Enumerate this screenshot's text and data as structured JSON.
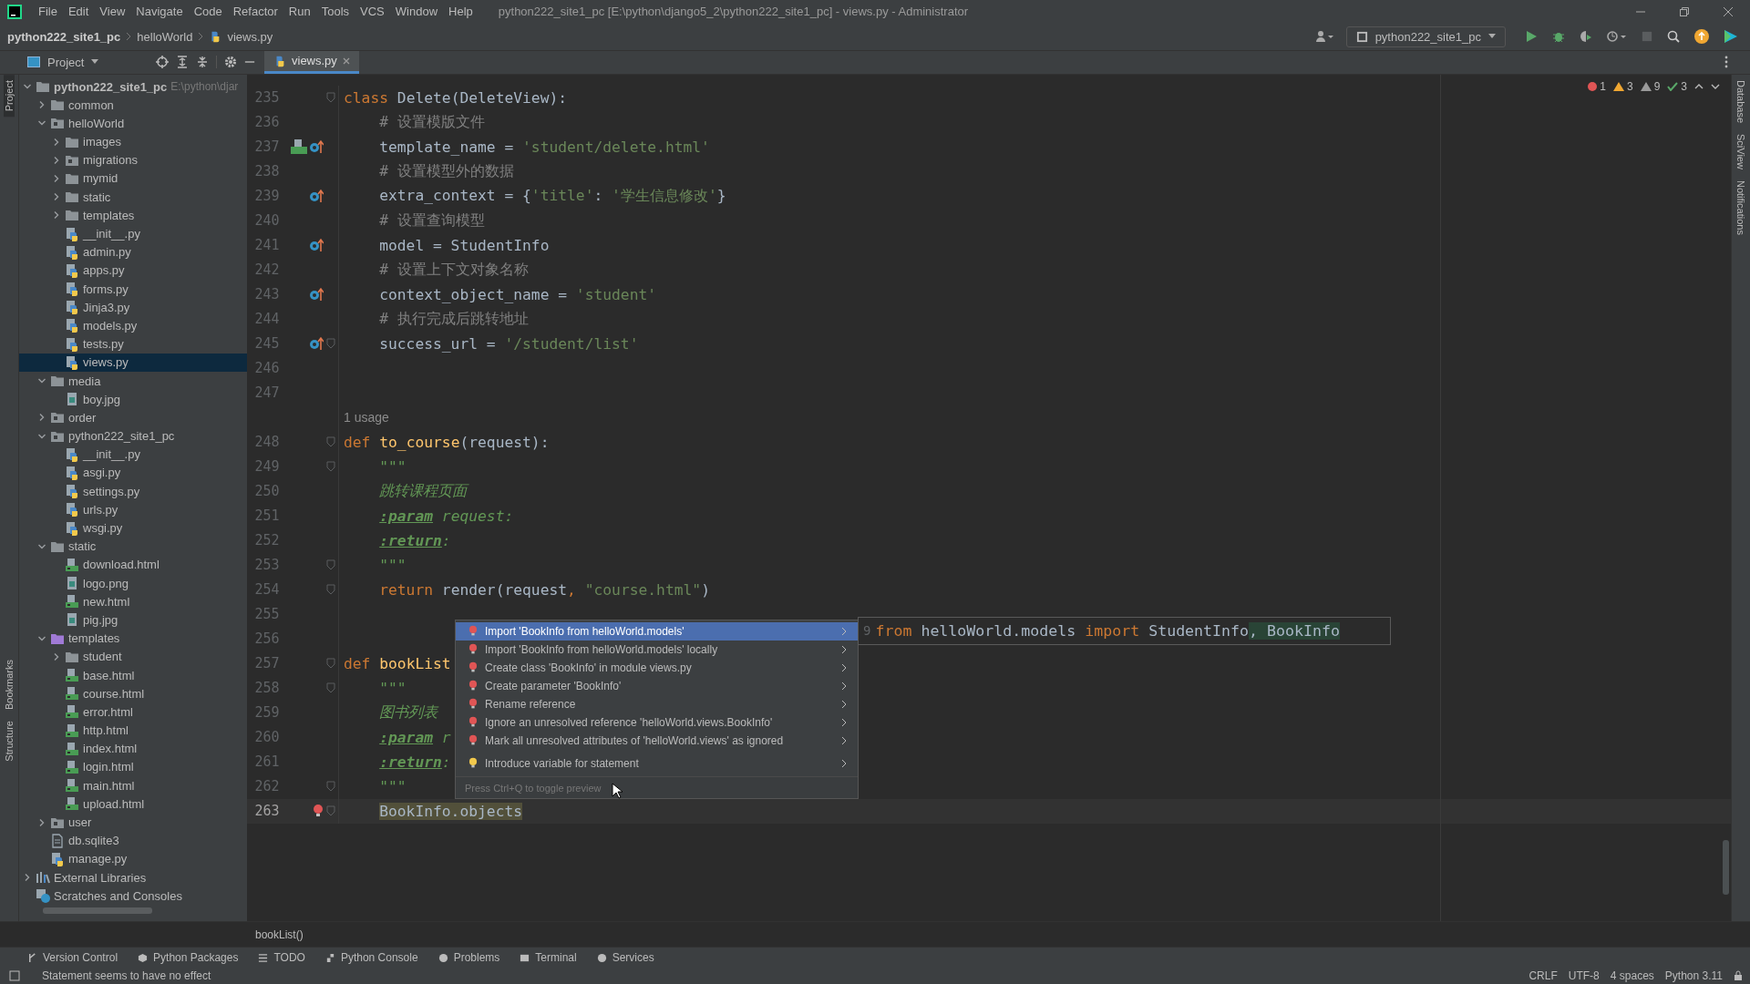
{
  "window": {
    "title": "python222_site1_pc [E:\\python\\django5_2\\python222_site1_pc] - views.py - Administrator"
  },
  "menu": [
    "File",
    "Edit",
    "View",
    "Navigate",
    "Code",
    "Refactor",
    "Run",
    "Tools",
    "VCS",
    "Window",
    "Help"
  ],
  "breadcrumb": [
    "python222_site1_pc",
    "helloWorld",
    "views.py"
  ],
  "run_config": "python222_site1_pc",
  "project_panel": {
    "title": "Project"
  },
  "left_stripe": [
    "Project",
    "Bookmarks",
    "Structure"
  ],
  "right_stripe": [
    "Database",
    "SciView",
    "Notifications"
  ],
  "tabs": [
    {
      "label": "views.py",
      "selected": true
    }
  ],
  "project_tree": [
    {
      "label": "python222_site1_pc",
      "hint": "E:\\python\\djar",
      "kind": "folder",
      "expanded": true,
      "selected": false,
      "children": [
        {
          "label": "common",
          "kind": "folder",
          "expanded": false,
          "selected": false
        },
        {
          "label": "helloWorld",
          "kind": "package",
          "expanded": true,
          "selected": false,
          "children": [
            {
              "label": "images",
              "kind": "folder",
              "expanded": false,
              "selected": false
            },
            {
              "label": "migrations",
              "kind": "package",
              "expanded": false,
              "selected": false
            },
            {
              "label": "mymid",
              "kind": "folder",
              "expanded": false,
              "selected": false
            },
            {
              "label": "static",
              "kind": "folder",
              "expanded": false,
              "selected": false
            },
            {
              "label": "templates",
              "kind": "folder",
              "expanded": false,
              "selected": false
            },
            {
              "label": "__init__.py",
              "kind": "python",
              "selected": false
            },
            {
              "label": "admin.py",
              "kind": "python",
              "selected": false
            },
            {
              "label": "apps.py",
              "kind": "python",
              "selected": false
            },
            {
              "label": "forms.py",
              "kind": "python",
              "selected": false
            },
            {
              "label": "Jinja3.py",
              "kind": "python",
              "selected": false
            },
            {
              "label": "models.py",
              "kind": "python",
              "selected": false
            },
            {
              "label": "tests.py",
              "kind": "python",
              "selected": false
            },
            {
              "label": "views.py",
              "kind": "python",
              "selected": true
            }
          ]
        },
        {
          "label": "media",
          "kind": "folder",
          "expanded": true,
          "selected": false,
          "children": [
            {
              "label": "boy.jpg",
              "kind": "image",
              "selected": false
            }
          ]
        },
        {
          "label": "order",
          "kind": "package",
          "expanded": false,
          "selected": false
        },
        {
          "label": "python222_site1_pc",
          "kind": "package",
          "expanded": true,
          "selected": false,
          "children": [
            {
              "label": "__init__.py",
              "kind": "python",
              "selected": false
            },
            {
              "label": "asgi.py",
              "kind": "python",
              "selected": false
            },
            {
              "label": "settings.py",
              "kind": "python",
              "selected": false
            },
            {
              "label": "urls.py",
              "kind": "python",
              "selected": false
            },
            {
              "label": "wsgi.py",
              "kind": "python",
              "selected": false
            }
          ]
        },
        {
          "label": "static",
          "kind": "folder",
          "expanded": true,
          "selected": false,
          "children": [
            {
              "label": "download.html",
              "kind": "html",
              "selected": false
            },
            {
              "label": "logo.png",
              "kind": "image",
              "selected": false
            },
            {
              "label": "new.html",
              "kind": "html",
              "selected": false
            },
            {
              "label": "pig.jpg",
              "kind": "image",
              "selected": false
            }
          ]
        },
        {
          "label": "templates",
          "kind": "template-folder",
          "expanded": true,
          "selected": false,
          "children": [
            {
              "label": "student",
              "kind": "folder",
              "expanded": false,
              "selected": false
            },
            {
              "label": "base.html",
              "kind": "html",
              "selected": false
            },
            {
              "label": "course.html",
              "kind": "html",
              "selected": false
            },
            {
              "label": "error.html",
              "kind": "html",
              "selected": false
            },
            {
              "label": "http.html",
              "kind": "html",
              "selected": false
            },
            {
              "label": "index.html",
              "kind": "html",
              "selected": false
            },
            {
              "label": "login.html",
              "kind": "html",
              "selected": false
            },
            {
              "label": "main.html",
              "kind": "html",
              "selected": false
            },
            {
              "label": "upload.html",
              "kind": "html",
              "selected": false
            }
          ]
        },
        {
          "label": "user",
          "kind": "package",
          "expanded": false,
          "selected": false
        },
        {
          "label": "db.sqlite3",
          "kind": "database",
          "selected": false
        },
        {
          "label": "manage.py",
          "kind": "python",
          "selected": false
        }
      ]
    },
    {
      "label": "External Libraries",
      "kind": "library",
      "expanded": false,
      "selected": false
    },
    {
      "label": "Scratches and Consoles",
      "kind": "scratch",
      "selected": false
    }
  ],
  "inspections": [
    {
      "kind": "error",
      "count": "1"
    },
    {
      "kind": "warning",
      "count": "3"
    },
    {
      "kind": "weak",
      "count": "9"
    },
    {
      "kind": "typo",
      "count": "3"
    }
  ],
  "code": [
    {
      "kind": "code",
      "number": "235",
      "fold": true,
      "current": false,
      "tokens": [
        {
          "kind": "keyword",
          "text": "class "
        },
        {
          "kind": "plain",
          "text": "Delete(DeleteView):"
        }
      ],
      "children": [
        {
          "kind": "code",
          "number": "236",
          "fold": false,
          "current": false,
          "tokens": [
            {
              "kind": "comment",
              "text": "# 设置模版文件"
            }
          ]
        },
        {
          "kind": "code",
          "number": "237",
          "gutter": {
            "kind": "html-override"
          },
          "fold": false,
          "current": false,
          "tokens": [
            {
              "kind": "plain",
              "text": "template_name = "
            },
            {
              "kind": "string",
              "text": "'student/delete.html'"
            }
          ]
        },
        {
          "kind": "code",
          "number": "238",
          "fold": false,
          "current": false,
          "tokens": [
            {
              "kind": "comment",
              "text": "# 设置模型外的数据"
            }
          ]
        },
        {
          "kind": "code",
          "number": "239",
          "gutter": {
            "kind": "override"
          },
          "fold": false,
          "current": false,
          "tokens": [
            {
              "kind": "plain",
              "text": "extra_context = {"
            },
            {
              "kind": "string",
              "text": "'title'"
            },
            {
              "kind": "plain",
              "text": ": "
            },
            {
              "kind": "string",
              "text": "'学生信息修改'"
            },
            {
              "kind": "plain",
              "text": "}"
            }
          ]
        },
        {
          "kind": "code",
          "number": "240",
          "fold": false,
          "current": false,
          "tokens": [
            {
              "kind": "comment",
              "text": "# 设置查询模型"
            }
          ]
        },
        {
          "kind": "code",
          "number": "241",
          "gutter": {
            "kind": "override"
          },
          "fold": false,
          "current": false,
          "tokens": [
            {
              "kind": "plain",
              "text": "model = StudentInfo"
            }
          ]
        },
        {
          "kind": "code",
          "number": "242",
          "fold": false,
          "current": false,
          "tokens": [
            {
              "kind": "comment",
              "text": "# 设置上下文对象名称"
            }
          ]
        },
        {
          "kind": "code",
          "number": "243",
          "gutter": {
            "kind": "override"
          },
          "fold": false,
          "current": false,
          "tokens": [
            {
              "kind": "plain",
              "text": "context_object_name = "
            },
            {
              "kind": "string",
              "text": "'student'"
            }
          ]
        },
        {
          "kind": "code",
          "number": "244",
          "fold": false,
          "current": false,
          "tokens": [
            {
              "kind": "comment",
              "text": "# 执行完成后跳转地址"
            }
          ]
        },
        {
          "kind": "code",
          "number": "245",
          "gutter": {
            "kind": "override"
          },
          "fold": true,
          "current": false,
          "tokens": [
            {
              "kind": "plain",
              "text": "success_url = "
            },
            {
              "kind": "string",
              "text": "'/student/list'"
            }
          ]
        }
      ]
    },
    {
      "kind": "code",
      "number": "246",
      "fold": false,
      "current": false
    },
    {
      "kind": "code",
      "number": "247",
      "fold": false,
      "current": false
    },
    {
      "kind": "inlay",
      "text": "1 usage"
    },
    {
      "kind": "code",
      "number": "248",
      "fold": true,
      "current": false,
      "tokens": [
        {
          "kind": "keyword",
          "text": "def "
        },
        {
          "kind": "function",
          "text": "to_course"
        },
        {
          "kind": "plain",
          "text": "(request):"
        }
      ],
      "children": [
        {
          "kind": "code",
          "number": "249",
          "fold": true,
          "current": false,
          "tokens": [
            {
              "kind": "docstring",
              "text": "\"\"\""
            }
          ]
        },
        {
          "kind": "code",
          "number": "250",
          "fold": false,
          "current": false,
          "tokens": [
            {
              "kind": "docstring",
              "text": "跳转课程页面"
            }
          ]
        },
        {
          "kind": "code",
          "number": "251",
          "fold": false,
          "current": false,
          "tokens": [
            {
              "kind": "doctag",
              "text": ":param"
            },
            {
              "kind": "docstring",
              "text": " request:"
            }
          ]
        },
        {
          "kind": "code",
          "number": "252",
          "fold": false,
          "current": false,
          "tokens": [
            {
              "kind": "doctag",
              "text": ":return"
            },
            {
              "kind": "docstring",
              "text": ":"
            }
          ]
        },
        {
          "kind": "code",
          "number": "253",
          "fold": true,
          "current": false,
          "tokens": [
            {
              "kind": "docstring",
              "text": "\"\"\""
            }
          ]
        },
        {
          "kind": "code",
          "number": "254",
          "fold": true,
          "current": false,
          "tokens": [
            {
              "kind": "keyword",
              "text": "return"
            },
            {
              "kind": "plain",
              "text": " render(request"
            },
            {
              "kind": "keyword",
              "text": ", "
            },
            {
              "kind": "string",
              "text": "\"course.html\""
            },
            {
              "kind": "plain",
              "text": ")"
            }
          ]
        }
      ]
    },
    {
      "kind": "code",
      "number": "255",
      "fold": false,
      "current": false
    },
    {
      "kind": "code",
      "number": "256",
      "fold": false,
      "current": false
    },
    {
      "kind": "code",
      "number": "257",
      "fold": true,
      "current": false,
      "tokens": [
        {
          "kind": "keyword",
          "text": "def "
        },
        {
          "kind": "function",
          "text": "bookList"
        }
      ],
      "children": [
        {
          "kind": "code",
          "number": "258",
          "fold": true,
          "current": false,
          "tokens": [
            {
              "kind": "docstring",
              "text": "\"\"\""
            }
          ]
        },
        {
          "kind": "code",
          "number": "259",
          "fold": false,
          "current": false,
          "tokens": [
            {
              "kind": "docstring",
              "text": "图书列表"
            }
          ]
        },
        {
          "kind": "code",
          "number": "260",
          "fold": false,
          "current": false,
          "tokens": [
            {
              "kind": "doctag",
              "text": ":param"
            },
            {
              "kind": "docstring",
              "text": " r"
            }
          ]
        },
        {
          "kind": "code",
          "number": "261",
          "fold": false,
          "current": false,
          "tokens": [
            {
              "kind": "doctag",
              "text": ":return"
            },
            {
              "kind": "docstring",
              "text": ":"
            }
          ]
        },
        {
          "kind": "code",
          "number": "262",
          "fold": true,
          "current": false,
          "tokens": [
            {
              "kind": "docstring",
              "text": "\"\"\""
            }
          ]
        },
        {
          "kind": "code",
          "number": "263",
          "gutter": {
            "kind": "error-bulb"
          },
          "fold": true,
          "current": true,
          "tokens": [
            {
              "kind": "unresolved",
              "text": "BookInfo.objects"
            }
          ]
        }
      ]
    }
  ],
  "quick_fix_menu": {
    "items": [
      {
        "label": "Import 'BookInfo from helloWorld.models'",
        "kind": "error",
        "selected": true
      },
      {
        "label": "Import 'BookInfo from helloWorld.models' locally",
        "kind": "error",
        "selected": false
      },
      {
        "label": "Create class 'BookInfo' in module views.py",
        "kind": "error",
        "selected": false
      },
      {
        "label": "Create parameter 'BookInfo'",
        "kind": "error",
        "selected": false
      },
      {
        "label": "Rename reference",
        "kind": "error",
        "selected": false
      },
      {
        "label": "Ignore an unresolved reference 'helloWorld.views.BookInfo'",
        "kind": "error",
        "selected": false
      },
      {
        "label": "Mark all unresolved attributes of 'helloWorld.views' as ignored",
        "kind": "error",
        "selected": false
      },
      {
        "label": "Introduce variable for statement",
        "kind": "intention",
        "selected": false
      }
    ],
    "hint": "Press Ctrl+Q to toggle preview",
    "preview": {
      "line_number": "9",
      "tokens": [
        {
          "kind": "keyword",
          "text": "from "
        },
        {
          "kind": "plain",
          "text": "helloWorld.models "
        },
        {
          "kind": "keyword",
          "text": "import "
        },
        {
          "kind": "plain",
          "text": "StudentInfo"
        },
        {
          "kind": "added",
          "text": ", BookInfo"
        }
      ]
    }
  },
  "editor_breadcrumb": "bookList()",
  "tool_windows": [
    {
      "label": "Version Control",
      "kind": "vcs"
    },
    {
      "label": "Python Packages",
      "kind": "packages"
    },
    {
      "label": "TODO",
      "kind": "todo"
    },
    {
      "label": "Python Console",
      "kind": "console"
    },
    {
      "label": "Problems",
      "kind": "problems"
    },
    {
      "label": "Terminal",
      "kind": "terminal"
    },
    {
      "label": "Services",
      "kind": "services"
    }
  ],
  "status_bar": {
    "message": "Statement seems to have no effect",
    "items": [
      "CRLF",
      "UTF-8",
      "4 spaces",
      "Python 3.11"
    ]
  }
}
